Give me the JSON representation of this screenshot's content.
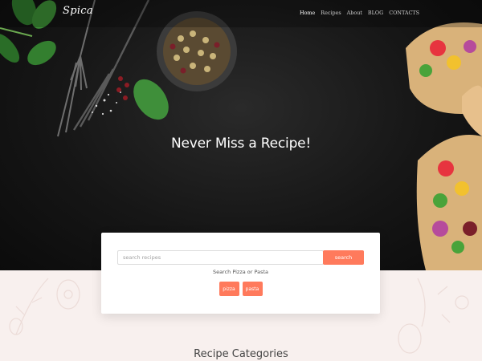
{
  "brand": {
    "logo_text": "Spica"
  },
  "nav": {
    "items": [
      {
        "label": "Home",
        "active": true
      },
      {
        "label": "Recipes",
        "active": false
      },
      {
        "label": "About",
        "active": false
      },
      {
        "label": "BLOG",
        "active": false
      },
      {
        "label": "CONTACTS",
        "active": false
      }
    ]
  },
  "hero": {
    "title": "Never Miss a Recipe!"
  },
  "search": {
    "placeholder": "search recipes",
    "value": "",
    "button_label": "search",
    "hint": "Search Pizza or Pasta",
    "tags": [
      "pizza",
      "pasta"
    ]
  },
  "sections": {
    "categories_title": "Recipe Categories"
  },
  "colors": {
    "accent": "#ff7a5c",
    "hero_bg": "#161616",
    "band_bg": "#f8f0ee",
    "text_dark": "#444444"
  }
}
